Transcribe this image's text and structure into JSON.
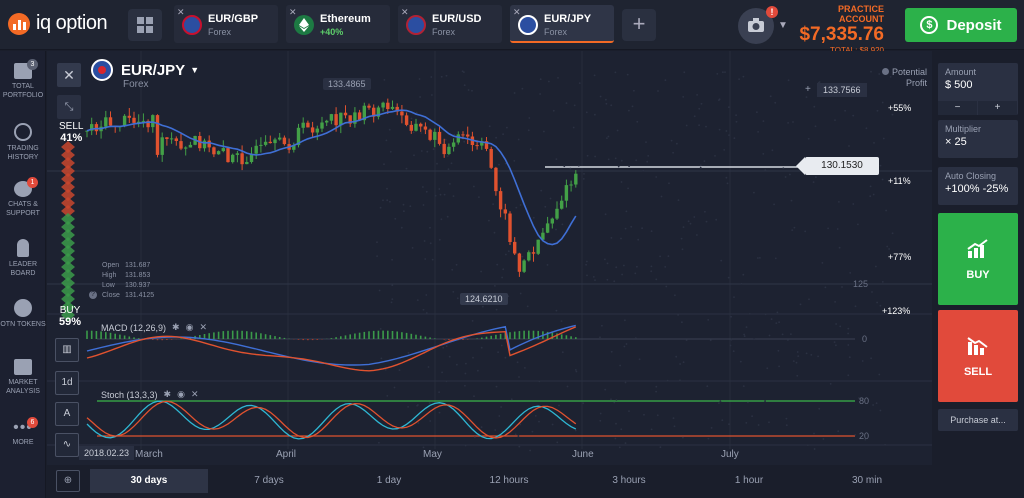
{
  "brand": {
    "name": "iq option"
  },
  "tabs": [
    {
      "name": "EUR/GBP",
      "sub": "Forex",
      "close": "✕"
    },
    {
      "name": "Ethereum",
      "sub": "+40%",
      "close": "✕"
    },
    {
      "name": "EUR/USD",
      "sub": "Forex",
      "close": "✕"
    },
    {
      "name": "EUR/JPY",
      "sub": "Forex",
      "close": "✕"
    }
  ],
  "add_tab": "+",
  "notification_count": "!",
  "account": {
    "label": "PRACTICE ACCOUNT",
    "balance": "$7,335.76",
    "total": "TOTAL: $8,920"
  },
  "deposit": {
    "label": "Deposit",
    "icon": "$"
  },
  "sidebar": {
    "items": [
      {
        "label": "TOTAL PORTFOLIO",
        "badge": "3"
      },
      {
        "label": "TRADING HISTORY",
        "badge": ""
      },
      {
        "label": "CHATS & SUPPORT",
        "badge": "1"
      },
      {
        "label": "LEADER BOARD",
        "badge": ""
      },
      {
        "label": "OTN TOKENS",
        "badge": ""
      },
      {
        "label": "MARKET ANALYSIS",
        "badge": ""
      },
      {
        "label": "MORE",
        "badge": "6"
      }
    ]
  },
  "chart": {
    "asset": "EUR/JPY",
    "asset_sub": "Forex",
    "close_icon": "✕",
    "sell_label": "SELL",
    "sell_pct": "41%",
    "buy_label": "BUY",
    "buy_pct": "59%",
    "ohlc": [
      {
        "k": "Open",
        "v": "131.687"
      },
      {
        "k": "High",
        "v": "131.853"
      },
      {
        "k": "Low",
        "v": "130.937"
      },
      {
        "k": "Close",
        "v": "131.4125"
      }
    ],
    "high_label": "133.4865",
    "low_label": "124.6210",
    "current_price": "130.1530",
    "top_price": "133.7566",
    "potential_profit": "Potential Profit",
    "profit_levels": [
      "+55%",
      "+11%",
      "+77%",
      "+123%"
    ],
    "axis_125": "125",
    "axis_macd_zero": "0",
    "stoch_80": "80",
    "stoch_20": "20",
    "macd_label": "MACD (12,26,9)",
    "stoch_label": "Stoch (13,3,3)",
    "date_label": "2018.02.23",
    "tool_1d": "1d",
    "months": [
      "March",
      "April",
      "May",
      "June",
      "July"
    ],
    "colors": {
      "up": "#43a047",
      "down": "#e0522f",
      "ma": "#3f6fd6"
    }
  },
  "timeframes": [
    "30 days",
    "7 days",
    "1 day",
    "12 hours",
    "3 hours",
    "1 hour",
    "30 min"
  ],
  "right_panel": {
    "amount_label": "Amount",
    "amount_value": "$  500",
    "minus": "−",
    "plus": "+",
    "multiplier_label": "Multiplier",
    "multiplier_value": "× 25",
    "auto_close_label": "Auto Closing",
    "auto_close_value": "+100%  -25%",
    "buy": "BUY",
    "sell": "SELL",
    "purchase_at": "Purchase at..."
  }
}
